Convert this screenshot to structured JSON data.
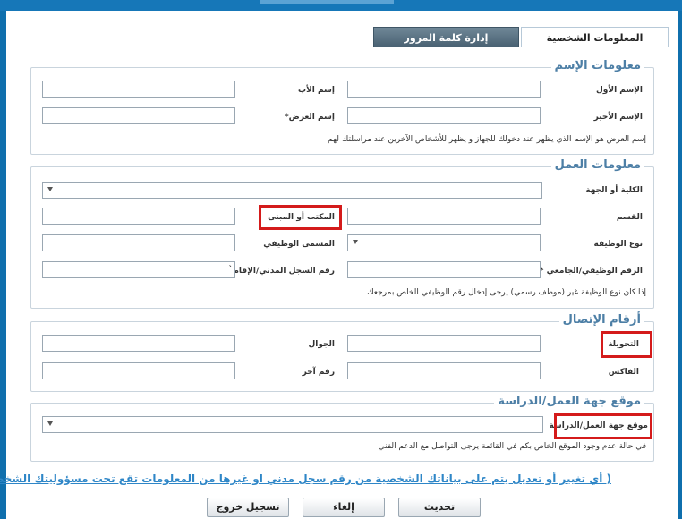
{
  "tabs": {
    "personal_info": "المعلومات الشخصية",
    "password_management": "إدارة كلمة المرور"
  },
  "name_section": {
    "legend": "معلومات الإسم",
    "first_name_label": "الإسم الأول",
    "father_name_label": "إسم الأب",
    "last_name_label": "الإسم الأخير",
    "display_name_label": "إسم العرض*",
    "note": "إسم العرض هو الإسم الذي يظهر عند دخولك للجهاز و يظهر للأشخاص الآخرين عند مراسلتك لهم"
  },
  "work_section": {
    "legend": "معلومات العمل",
    "college_label": "الكلية أو الجهة",
    "department_label": "القسم",
    "office_label": "المكتب أو المبنى",
    "job_type_label": "نوع الوظيفة",
    "job_title_label": "المسمى الوظيفي",
    "employee_id_label": "الرقم الوظيفي/الجامعي *",
    "civil_id_label": "رقم السجل المدني/الإقامة",
    "civil_id_value": "`",
    "note": "إذا كان نوع الوظيفة غير (موظف رسمي) يرجى إدخال رقم الوظيفي الخاص بمرجعك"
  },
  "contact_section": {
    "legend": "أرقام الإتصال",
    "extension_label": "التحويلة",
    "mobile_label": "الجوال",
    "fax_label": "الفاكس",
    "other_label": "رقم آخر"
  },
  "location_section": {
    "legend": "موقع جهة العمل/الدراسة",
    "location_label": "موقع جهة العمل/الدراسة",
    "note": "في حالة عدم وجود الموقع الخاص بكم في القائمة يرجى التواصل مع الدعم الفني"
  },
  "disclaimer": "( أي تغيير أو تعديل يتم على بياناتك الشخصية من رقم سجل مدني او غيرها من المعلومات تقع تحت مسؤوليتك الشخصية )",
  "buttons": {
    "update": "تحديث",
    "cancel": "إلغاء",
    "logout": "تسجيل خروج"
  },
  "colors": {
    "frame": "#0f6fad",
    "legend": "#4d7fa6",
    "highlight": "#d41b1b",
    "disclaimer": "#2e86c7"
  }
}
